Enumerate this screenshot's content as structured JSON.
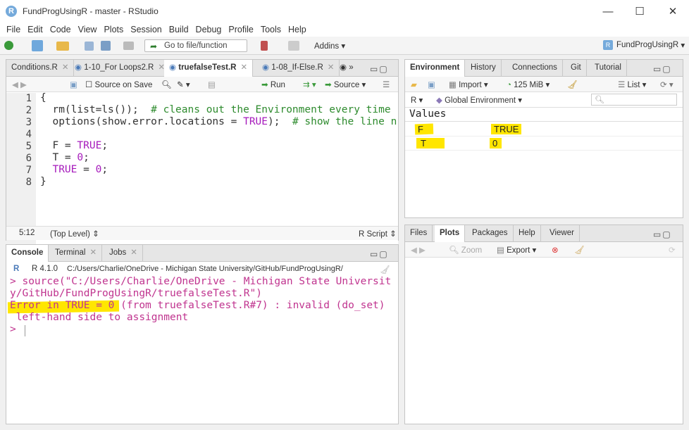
{
  "window": {
    "title": "FundProgUsingR - master - RStudio",
    "app_icon_letter": "R",
    "minimize": "—",
    "maximize": "☐",
    "close": "✕"
  },
  "menu": [
    "File",
    "Edit",
    "Code",
    "View",
    "Plots",
    "Session",
    "Build",
    "Debug",
    "Profile",
    "Tools",
    "Help"
  ],
  "toolbar": {
    "goto_placeholder": "Go to file/function",
    "addins_label": "Addins",
    "project_label": "FundProgUsingR",
    "project_icon": "R"
  },
  "editor": {
    "tabs": [
      {
        "label": "Conditions.R"
      },
      {
        "label": "1-10_For Loops2.R"
      },
      {
        "label": "truefalseTest.R"
      },
      {
        "label": "1-08_If-Else.R"
      }
    ],
    "toolbar": {
      "source_on_save": "Source on Save",
      "run": "Run",
      "source": "Source"
    },
    "line_numbers": [
      "1",
      "2",
      "3",
      "4",
      "5",
      "6",
      "7",
      "8"
    ],
    "status": {
      "position": "5:12",
      "scope": "(Top Level)",
      "filetype": "R Script"
    }
  },
  "console": {
    "tabs": [
      "Console",
      "Terminal",
      "Jobs"
    ],
    "r_version": "R 4.1.0",
    "path": "C:/Users/Charlie/OneDrive - Michigan State University/GitHub/FundProgUsingR/",
    "lines": [
      "> source(\"C:/Users/Charlie/OneDrive - Michigan State Universit",
      "y/GitHub/FundProgUsingR/truefalseTest.R\")",
      "Error in TRUE = 0 (from truefalseTest.R#7) : invalid (do_set)",
      " left-hand side to assignment",
      ">"
    ]
  },
  "environment": {
    "tabs": [
      "Environment",
      "History",
      "Connections",
      "Git",
      "Tutorial"
    ],
    "import_label": "Import",
    "memory": "125 MiB",
    "list_label": "List",
    "r_label": "R",
    "scope_label": "Global Environment",
    "section": "Values",
    "rows": [
      {
        "name": "F",
        "value": "TRUE"
      },
      {
        "name": "T",
        "value": "0"
      }
    ]
  },
  "files": {
    "tabs": [
      "Files",
      "Plots",
      "Packages",
      "Help",
      "Viewer"
    ],
    "zoom_label": "Zoom",
    "export_label": "Export"
  }
}
